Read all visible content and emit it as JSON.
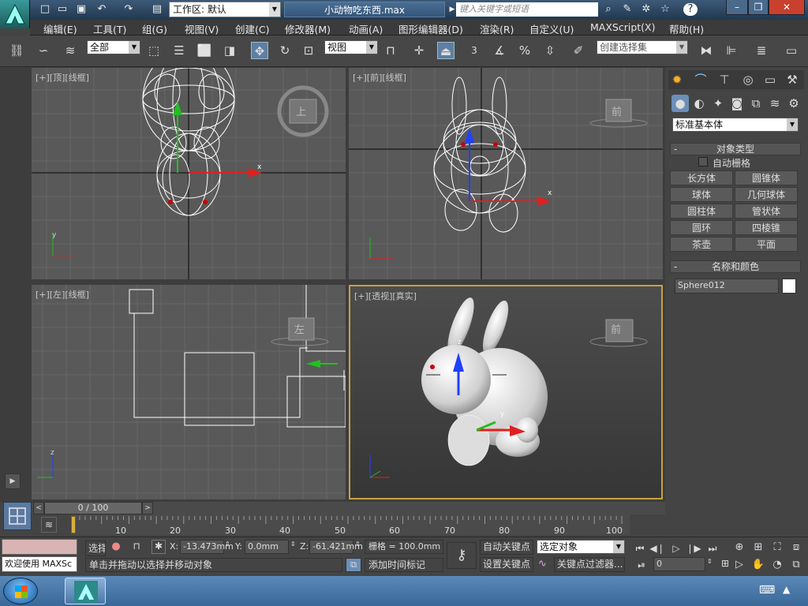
{
  "title_bar": {
    "workspace_label": "工作区: 默认",
    "file_title": "小动物吃东西.max",
    "search_placeholder": "键入关键字或短语",
    "window_controls": [
      "minimize-icon",
      "restore-icon",
      "close-icon"
    ]
  },
  "menu": [
    "编辑(E)",
    "工具(T)",
    "组(G)",
    "视图(V)",
    "创建(C)",
    "修改器(M)",
    "动画(A)",
    "图形编辑器(D)",
    "渲染(R)",
    "自定义(U)",
    "MAXScript(X)",
    "帮助(H)"
  ],
  "toolbar": {
    "selection_filter": "全部",
    "reference_coord": "视图",
    "snap_value": "3",
    "percent_label": "%",
    "named_selection_placeholder": "创建选择集"
  },
  "viewports": [
    {
      "id": "top",
      "label": "[+][顶][线框]",
      "viewcube": "上"
    },
    {
      "id": "front",
      "label": "[+][前][线框]",
      "viewcube": "前"
    },
    {
      "id": "left",
      "label": "[+][左][线框]",
      "viewcube": "左"
    },
    {
      "id": "perspective",
      "label": "[+][透视][真实]",
      "viewcube": "前",
      "active": true
    }
  ],
  "axis_labels": {
    "x": "x",
    "y": "y",
    "z": "z"
  },
  "command_panel": {
    "category": "标准基本体",
    "object_type_title": "对象类型",
    "autogrid_label": "自动栅格",
    "buttons": [
      "长方体",
      "圆锥体",
      "球体",
      "几何球体",
      "圆柱体",
      "管状体",
      "圆环",
      "四棱锥",
      "茶壶",
      "平面"
    ],
    "name_color_title": "名称和颜色",
    "object_name": "Sphere012",
    "object_color": "#ffffff"
  },
  "timeline": {
    "frame_display": "0 / 100",
    "ticks": [
      "10",
      "20",
      "30",
      "40",
      "50",
      "60",
      "70",
      "80",
      "90",
      "100"
    ],
    "current_frame": 0,
    "total_frames": 100
  },
  "status": {
    "welcome": "欢迎使用 MAXSc",
    "selected_label": "选择",
    "x_label": "X:",
    "x_value": "-13.473mm",
    "y_label": "Y:",
    "y_value": "0.0mm",
    "z_label": "Z:",
    "z_value": "-61.421mm",
    "grid": "栅格 = 100.0mm",
    "prompt": "单击并拖动以选择并移动对象",
    "add_time_tag": "添加时间标记",
    "auto_key": "自动关键点",
    "set_key": "设置关键点",
    "key_mode": "选定对象",
    "key_filter": "关键点过滤器...",
    "frame_field": "0"
  },
  "colors": {
    "viewport_bg": "#595959",
    "active_border": "#c9a13f",
    "x_axis": "#e02020",
    "y_axis": "#20c020",
    "z_axis": "#2040ff"
  }
}
